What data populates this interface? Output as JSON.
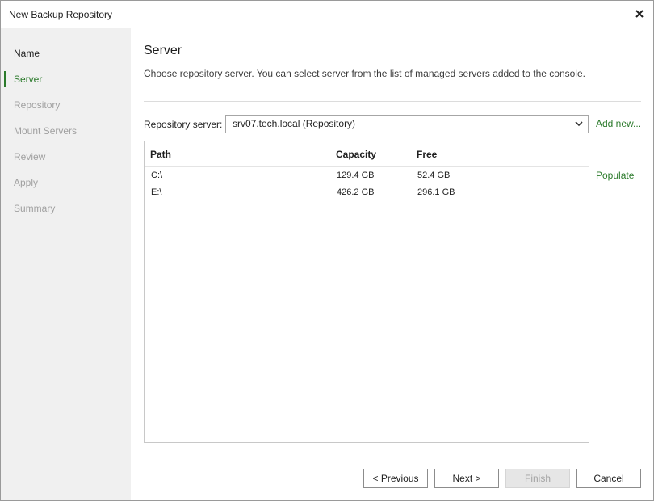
{
  "window": {
    "title": "New Backup Repository"
  },
  "sidebar": {
    "steps": [
      {
        "label": "Name",
        "state": "done"
      },
      {
        "label": "Server",
        "state": "active"
      },
      {
        "label": "Repository",
        "state": "pending"
      },
      {
        "label": "Mount Servers",
        "state": "pending"
      },
      {
        "label": "Review",
        "state": "pending"
      },
      {
        "label": "Apply",
        "state": "pending"
      },
      {
        "label": "Summary",
        "state": "pending"
      }
    ]
  },
  "main": {
    "heading": "Server",
    "description": "Choose repository server. You can select server from the list of managed servers added to the console.",
    "server_label": "Repository server:",
    "server_value": "srv07.tech.local (Repository)",
    "add_new": "Add new...",
    "populate": "Populate",
    "table": {
      "columns": [
        "Path",
        "Capacity",
        "Free"
      ],
      "rows": [
        {
          "path": "C:\\",
          "capacity": "129.4 GB",
          "free": "52.4 GB"
        },
        {
          "path": "E:\\",
          "capacity": "426.2 GB",
          "free": "296.1 GB"
        }
      ]
    }
  },
  "buttons": {
    "previous": "< Previous",
    "next": "Next >",
    "finish": "Finish",
    "cancel": "Cancel"
  },
  "colors": {
    "accent": "#2b7a2b",
    "sidebar_bg": "#f0f0f0",
    "disabled_text": "#a0a0a0"
  }
}
